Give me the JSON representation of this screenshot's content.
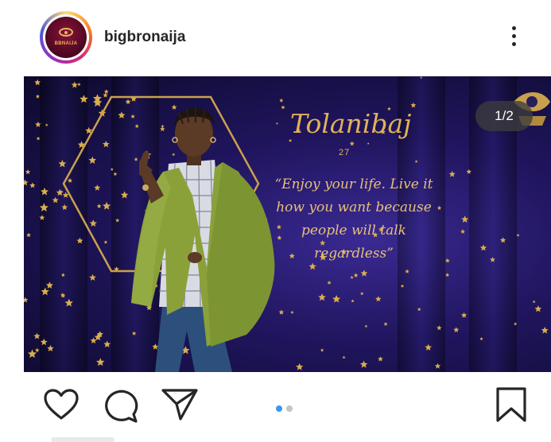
{
  "post": {
    "username": "bigbronaija",
    "avatar_text": "BBNAIJA",
    "slide_counter": "1/2",
    "active_slide": 1,
    "total_slides": 2,
    "image": {
      "name": "Tolanibaj",
      "age": "27",
      "quote": "“Enjoy your life. Live it how you want because people will talk regardless”"
    }
  },
  "colors": {
    "accent_blue": "#3897f0",
    "inactive_dot": "#c4c4c4",
    "poster_gold": "#e0b257",
    "poster_bg": "#20155e"
  },
  "icons": {
    "more": "more-vertical-icon",
    "like": "heart-icon",
    "comment": "comment-icon",
    "share": "paper-plane-icon",
    "save": "bookmark-icon"
  }
}
